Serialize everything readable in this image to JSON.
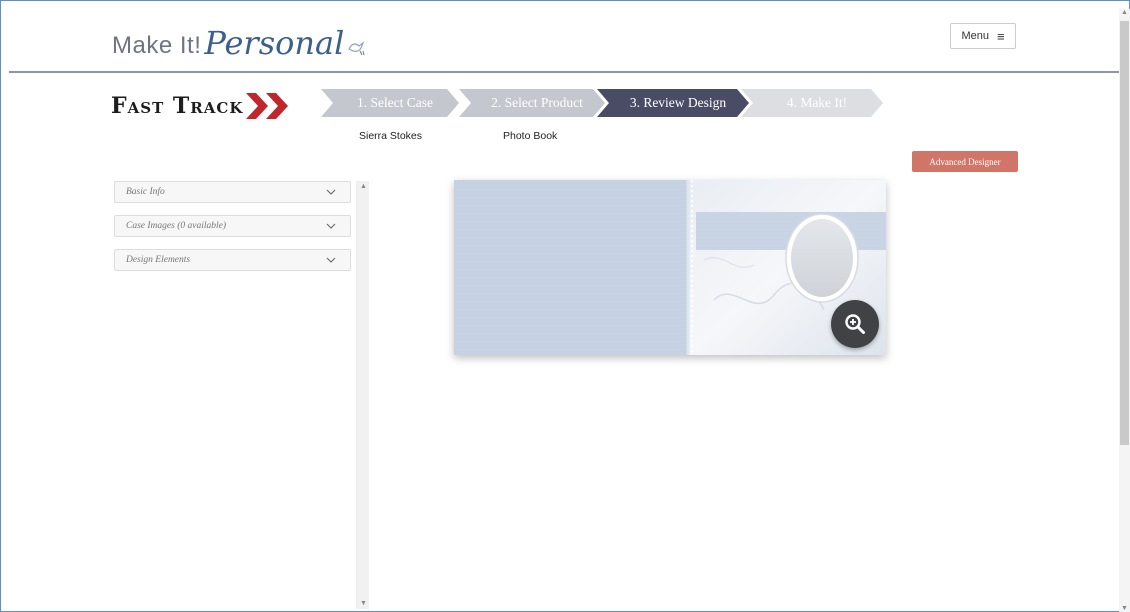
{
  "header": {
    "logo_make": "Make It!",
    "logo_personal": "Personal",
    "logo_icon": "dove-logo-icon",
    "menu_label": "Menu",
    "menu_icon": "hamburger-icon"
  },
  "fast_track": {
    "title": "Fast Track",
    "steps": [
      {
        "label": "1. Select Case",
        "sub": "Sierra Stokes",
        "state": "done"
      },
      {
        "label": "2. Select Product",
        "sub": "Photo Book",
        "state": "done"
      },
      {
        "label": "3. Review Design",
        "sub": "",
        "state": "active"
      },
      {
        "label": "4. Make It!",
        "sub": "",
        "state": "pending"
      }
    ]
  },
  "advanced_designer_label": "Advanced Designer",
  "sidebar": {
    "sections": [
      {
        "label": "Basic Info"
      },
      {
        "label": "Case Images (0 available)"
      },
      {
        "label": "Design Elements"
      }
    ]
  },
  "preview": {
    "zoom_icon": "zoom-in-icon"
  },
  "colors": {
    "step_done": "#c4c7ce",
    "step_active": "#4a4c66",
    "step_pending": "#dcdee2",
    "accent_button": "#d17569",
    "chevron": "#c0272d",
    "logo_blue": "#3c5f8e"
  }
}
